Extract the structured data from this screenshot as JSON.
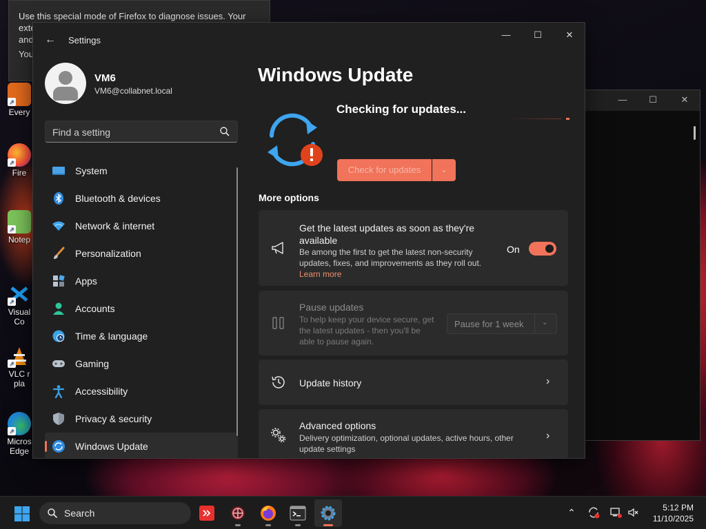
{
  "desktop": {
    "icons": [
      {
        "label_lines": [
          "Every"
        ]
      },
      {
        "label_lines": [
          "Fire"
        ]
      },
      {
        "label_lines": [
          "Notep"
        ]
      },
      {
        "label_lines": [
          "Visual",
          "Co"
        ]
      },
      {
        "label_lines": [
          "VLC r",
          "pla"
        ]
      },
      {
        "label_lines": [
          "Micros",
          "Edge"
        ]
      }
    ]
  },
  "background_notification": {
    "line1": "Use this special mode of Firefox to diagnose issues. Your extensions",
    "line2": "and",
    "line3": "You"
  },
  "settings_window": {
    "app_title": "Settings",
    "back_icon": "arrow-left-icon",
    "caption": {
      "minimize": "—",
      "maximize": "☐",
      "close": "✕"
    },
    "profile": {
      "name": "VM6",
      "email": "VM6@collabnet.local"
    },
    "search": {
      "placeholder": "Find a setting",
      "icon": "search-icon"
    },
    "nav": [
      {
        "label": "System",
        "icon": "system-icon",
        "selected": false
      },
      {
        "label": "Bluetooth & devices",
        "icon": "bluetooth-icon",
        "selected": false
      },
      {
        "label": "Network & internet",
        "icon": "wifi-icon",
        "selected": false
      },
      {
        "label": "Personalization",
        "icon": "brush-icon",
        "selected": false
      },
      {
        "label": "Apps",
        "icon": "apps-icon",
        "selected": false
      },
      {
        "label": "Accounts",
        "icon": "accounts-icon",
        "selected": false
      },
      {
        "label": "Time & language",
        "icon": "globe-clock-icon",
        "selected": false
      },
      {
        "label": "Gaming",
        "icon": "gamepad-icon",
        "selected": false
      },
      {
        "label": "Accessibility",
        "icon": "accessibility-icon",
        "selected": false
      },
      {
        "label": "Privacy & security",
        "icon": "shield-icon",
        "selected": false
      },
      {
        "label": "Windows Update",
        "icon": "windows-update-icon",
        "selected": true
      }
    ],
    "main": {
      "page_title": "Windows Update",
      "status_icon": "sync-warning-icon",
      "status_text": "Checking for updates...",
      "check_button_label": "Check for updates",
      "check_dropdown_icon": "chevron-down-icon",
      "section_label": "More options",
      "latest_updates": {
        "icon": "megaphone-icon",
        "title": "Get the latest updates as soon as they're available",
        "description": "Be among the first to get the latest non-security updates, fixes, and improvements as they roll out.",
        "link": "Learn more",
        "toggle_label": "On",
        "toggle_on": true
      },
      "pause_updates": {
        "icon": "pause-icon",
        "title": "Pause updates",
        "description": "To help keep your device secure, get the latest updates - then you'll be able to pause again.",
        "select_value": "Pause for 1 week",
        "enabled": false
      },
      "update_history": {
        "icon": "history-icon",
        "title": "Update history"
      },
      "advanced_options": {
        "icon": "gears-icon",
        "title": "Advanced options",
        "description": "Delivery optimization, optional updates, active hours, other update settings"
      }
    }
  },
  "taskbar": {
    "search_label": "Search",
    "apps": [
      {
        "name": "anydesk-icon"
      },
      {
        "name": "vlc-icon"
      },
      {
        "name": "firefox-icon"
      },
      {
        "name": "terminal-icon"
      },
      {
        "name": "settings-gear-icon"
      }
    ],
    "clock": {
      "time": "5:12 PM",
      "date": "11/10/2025"
    },
    "colors": {
      "accent": "#f0735a"
    }
  }
}
